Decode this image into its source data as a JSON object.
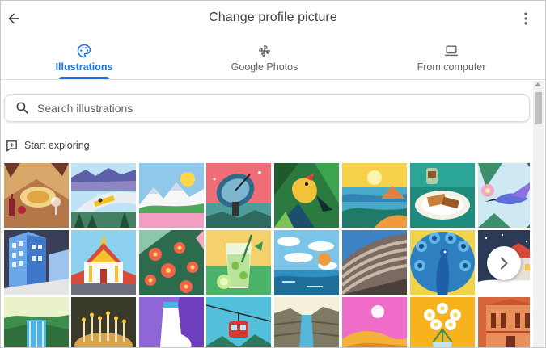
{
  "header": {
    "title": "Change profile picture",
    "back_icon": "arrow-back-icon",
    "more_icon": "more-vert-icon"
  },
  "tabs": [
    {
      "label": "Illustrations",
      "icon": "palette-icon",
      "active": true
    },
    {
      "label": "Google Photos",
      "icon": "pinwheel-icon",
      "active": false
    },
    {
      "label": "From computer",
      "icon": "laptop-icon",
      "active": false
    }
  ],
  "search": {
    "placeholder": "Search illustrations",
    "value": "",
    "icon": "search-icon"
  },
  "section": {
    "label": "Start exploring",
    "icon": "add-box-icon"
  },
  "illustrations": [
    "tuscan-food-table",
    "bobsled-track",
    "mountain-meadow",
    "satellite-dish",
    "jungle-bird",
    "sunny-coast",
    "pastry-plate",
    "hummingbird",
    "city-buildings",
    "thai-temple",
    "flower-garden",
    "mojito-glass",
    "clouds-sea",
    "striped-hills",
    "peacock",
    "snowy-house",
    "waterfall-cliff",
    "birthday-candles",
    "ice-skate",
    "cable-car",
    "river-canyon",
    "pink-dunes",
    "flower-vase",
    "petra-facade"
  ],
  "colors": {
    "accent": "#1a73e8",
    "text_primary": "#202124",
    "text_secondary": "#5f6368",
    "divider": "#e0e0e0"
  },
  "next_icon": "chevron-right-icon"
}
